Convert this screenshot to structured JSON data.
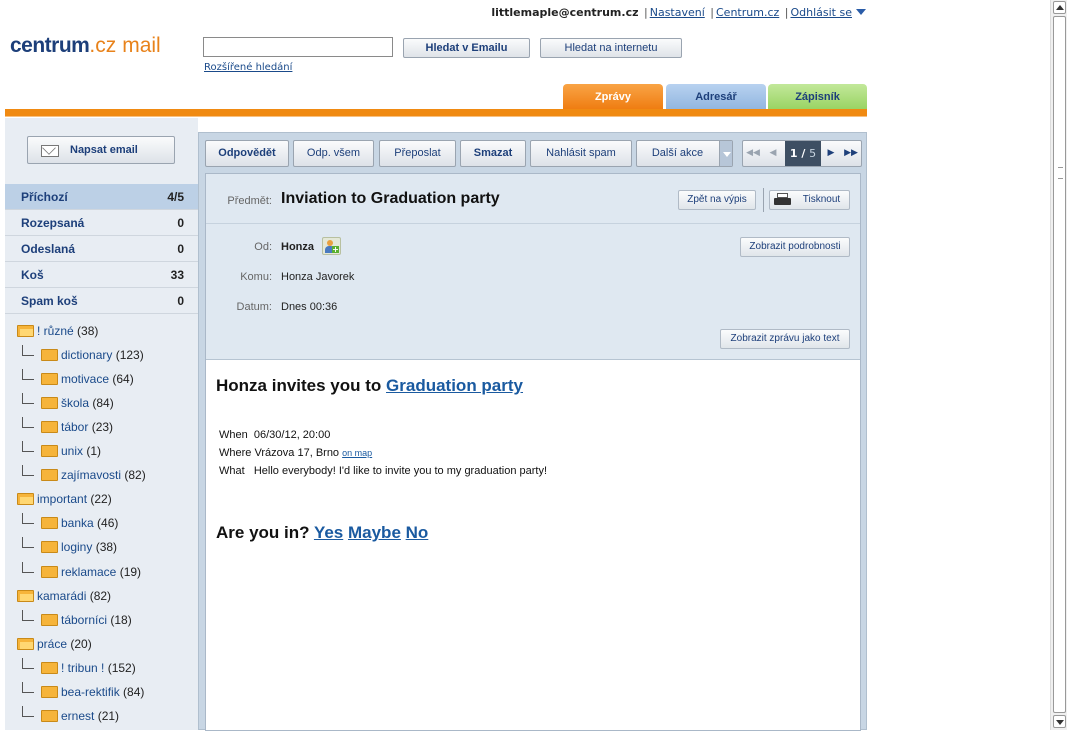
{
  "user": {
    "email": "littlemaple@centrum.cz",
    "settings": "Nastavení",
    "centrum": "Centrum.cz",
    "logout": "Odhlásit se"
  },
  "logo": {
    "part1": "centrum",
    "part2": ".cz",
    "part3": "mail"
  },
  "search": {
    "value": "",
    "search_email": "Hledat v Emailu",
    "search_web": "Hledat na internetu",
    "advanced": "Rozšířené hledání"
  },
  "tabs": [
    {
      "label": "Zprávy",
      "color": "#ef7d12",
      "active": true
    },
    {
      "label": "Adresář",
      "color": "#92b6e0"
    },
    {
      "label": "Zápisník",
      "color": "#9ad464"
    }
  ],
  "sidebar": {
    "compose": "Napsat email",
    "folders": [
      {
        "name": "Příchozí",
        "count": "4/5",
        "selected": true
      },
      {
        "name": "Rozepsaná",
        "count": "0"
      },
      {
        "name": "Odeslaná",
        "count": "0"
      },
      {
        "name": "Koš",
        "count": "33"
      },
      {
        "name": "Spam koš",
        "count": "0"
      }
    ],
    "tree": [
      {
        "name": "! různé",
        "count": "(38)"
      },
      {
        "name": "dictionary",
        "count": "(123)"
      },
      {
        "name": "motivace",
        "count": "(64)"
      },
      {
        "name": "škola",
        "count": "(84)"
      },
      {
        "name": "tábor",
        "count": "(23)"
      },
      {
        "name": "unix",
        "count": "(1)"
      },
      {
        "name": "zajímavosti",
        "count": "(82)"
      },
      {
        "name": "important",
        "count": "(22)"
      },
      {
        "name": "banka",
        "count": "(46)"
      },
      {
        "name": "loginy",
        "count": "(38)"
      },
      {
        "name": "reklamace",
        "count": "(19)"
      },
      {
        "name": "kamarádi",
        "count": "(82)"
      },
      {
        "name": "táborníci",
        "count": "(18)"
      },
      {
        "name": "práce",
        "count": "(20)"
      },
      {
        "name": "! tribun !",
        "count": "(152)"
      },
      {
        "name": "bea-rektifik",
        "count": "(84)"
      },
      {
        "name": "ernest",
        "count": "(21)"
      }
    ]
  },
  "toolbar": {
    "reply": "Odpovědět",
    "reply_all": "Odp. všem",
    "forward": "Přeposlat",
    "delete": "Smazat",
    "report_spam": "Nahlásit spam",
    "more": "Další akce"
  },
  "pager": {
    "current": "1",
    "total": "5",
    "first": "◀◀",
    "prev": "◀",
    "next": "▶",
    "last": "▶▶"
  },
  "message": {
    "subject_label": "Předmět:",
    "subject": "Inviation to Graduation party",
    "back": "Zpět na výpis",
    "print": "Tisknout",
    "from_label": "Od:",
    "from": "Honza",
    "details": "Zobrazit podrobnosti",
    "to_label": "Komu:",
    "to": "Honza Javorek",
    "date_label": "Datum:",
    "date": "Dnes 00:36",
    "as_text": "Zobrazit zprávu jako text"
  },
  "body": {
    "title_prefix": "Honza invites you to",
    "title_link": "Graduation party",
    "when_label": "When",
    "when": "06/30/12, 20:00",
    "where_label": "Where",
    "where": "Vrázova 17, Brno",
    "on_map": "on map",
    "what_label": "What",
    "what": "Hello everybody! I'd like to invite you to my graduation party!",
    "rsvp_prefix": "Are you in?",
    "yes": "Yes",
    "maybe": "Maybe",
    "no": "No"
  }
}
